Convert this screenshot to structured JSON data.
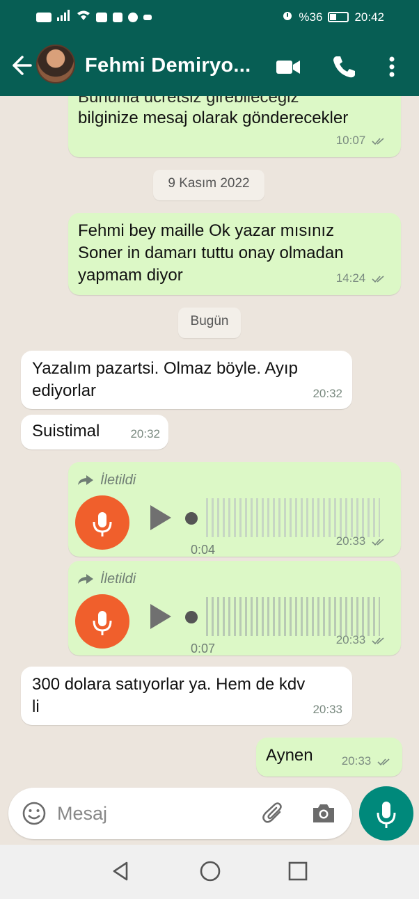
{
  "status_bar": {
    "battery_percent": "%36",
    "time": "20:42"
  },
  "header": {
    "contact_name": "Fehmi Demiryo..."
  },
  "messages": [
    {
      "type": "out",
      "text_top_partial": "Bununla ucretsiz girebilecegiz",
      "text": "bilginize mesaj olarak gönderecekler",
      "time": "10:07"
    },
    {
      "type": "date",
      "text": "9 Kasım 2022"
    },
    {
      "type": "out",
      "text": "Fehmi bey maille Ok yazar mısınız Soner in damarı tuttu onay olmadan yapmam diyor",
      "lines": [
        "Fehmi bey maille Ok yazar mısınız",
        "Soner in damarı tuttu onay olmadan",
        "yapmam diyor"
      ],
      "time": "14:24"
    },
    {
      "type": "date",
      "text": "Bugün"
    },
    {
      "type": "in",
      "lines": [
        "Yazalım pazartsi. Olmaz böyle. Ayıp",
        "ediyorlar"
      ],
      "time": "20:32"
    },
    {
      "type": "in",
      "text": "Suistimal",
      "time": "20:32"
    },
    {
      "type": "voice",
      "forwarded_label": "İletildi",
      "duration": "0:04",
      "time": "20:33"
    },
    {
      "type": "voice",
      "forwarded_label": "İletildi",
      "duration": "0:07",
      "time": "20:33"
    },
    {
      "type": "in",
      "lines": [
        "300 dolara satıyorlar ya. Hem de kdv",
        "li"
      ],
      "time": "20:33"
    },
    {
      "type": "out",
      "text": "Aynen",
      "time": "20:33"
    }
  ],
  "composer": {
    "placeholder": "Mesaj"
  },
  "colors": {
    "header": "#075e54",
    "outgoing_bubble": "#dcf8c6",
    "incoming_bubble": "#ffffff",
    "chat_background": "#ece5dd",
    "voice_mic": "#f05f2c",
    "send_button": "#00897b"
  },
  "icons": {
    "back": "arrow-left-icon",
    "video": "video-camera-icon",
    "call": "phone-icon",
    "menu": "more-vertical-icon",
    "emoji": "emoji-icon",
    "attach": "paperclip-icon",
    "camera": "camera-icon",
    "mic": "microphone-icon",
    "forwarded": "forward-arrow-icon",
    "play": "play-icon",
    "read": "double-check-icon"
  }
}
